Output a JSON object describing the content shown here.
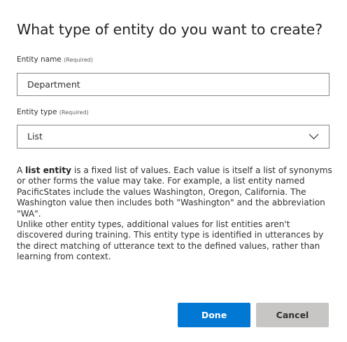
{
  "dialog": {
    "title": "What type of entity do you want to create?"
  },
  "form": {
    "entity_name": {
      "label": "Entity name",
      "required_tag": "(Required)",
      "value": "Department"
    },
    "entity_type": {
      "label": "Entity type",
      "required_tag": "(Required)",
      "selected": "List"
    }
  },
  "description": {
    "p1_prefix": "A ",
    "p1_bold": "list entity",
    "p1_rest": " is a fixed list of values. Each value is itself a list of synonyms or other forms the value may take. For example, a list entity named PacificStates include the values Washington, Oregon, California. The Washington value then includes both \"Washington\" and the abbreviation \"WA\".",
    "p2": "Unlike other entity types, additional values for list entities aren't discovered during training. This entity type is identified in utterances by the direct matching of utterance text to the defined values, rather than learning from context."
  },
  "buttons": {
    "done": "Done",
    "cancel": "Cancel"
  },
  "colors": {
    "primary": "#0078d4",
    "secondary": "#c8c6c4",
    "border": "#8a8886",
    "text": "#323130"
  },
  "icons": {
    "dropdown": "chevron-down-icon"
  }
}
